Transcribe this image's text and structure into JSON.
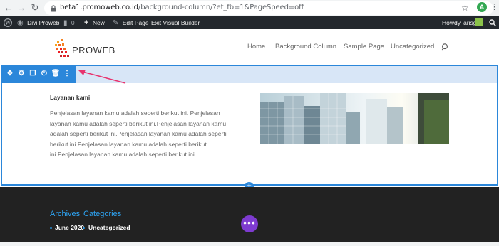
{
  "browser": {
    "url_host": "beta1.promoweb.co.id",
    "url_path": "/background-column/?et_fb=1&PageSpeed=off",
    "profile_initial": "A"
  },
  "adminbar": {
    "site_name": "Divi Proweb",
    "comments_count": "0",
    "new_label": "New",
    "edit_page_label": "Edit Page",
    "exit_builder_label": "Exit Visual Builder",
    "greeting": "Howdy, arisg"
  },
  "header": {
    "logo_text": "PROWEB",
    "menu": [
      "Home",
      "Background Column",
      "Sample Page",
      "Uncategorized"
    ]
  },
  "section": {
    "title": "Layanan kami",
    "body": "Penjelasan layanan kamu adalah seperti berikut ini. Penjelasan layanan kamu adalah seperti berikut ini.Penjelasan layanan kamu adalah seperti berikut ini.Penjelasan layanan kamu adalah seperti berikut ini.Penjelasan layanan kamu adalah seperti berikut ini.Penjelasan layanan kamu adalah seperti berikut ini."
  },
  "footer": {
    "archives_title": "Archives",
    "categories_title": "Categories",
    "archive_item": "June 2020",
    "category_item": "Uncategorized"
  },
  "colors": {
    "divi_blue": "#2b87da",
    "divi_purple": "#7e3bd0",
    "adminbar": "#23282d",
    "footer": "#222222",
    "footer_link": "#2ea3f2",
    "arrow": "#e8336e"
  },
  "icons": {
    "toolbar": [
      "move-icon",
      "settings-icon",
      "duplicate-icon",
      "power-icon",
      "delete-icon",
      "more-icon"
    ]
  }
}
